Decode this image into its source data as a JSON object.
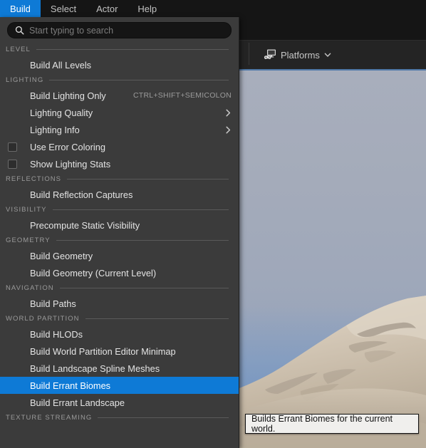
{
  "colors": {
    "accent": "#0e7ad6",
    "menu_bg": "#3b3b3b",
    "chrome_bg": "#151515",
    "toolbar_bg": "#242424",
    "tooltip_bg": "#f0efed",
    "text": "#e4e4e4",
    "section_text": "#9a9a9a",
    "shortcut_text": "#9b9b9b",
    "sky_top": "#a8aebc",
    "sky_bottom": "#7e9ac0",
    "terrain": "#cfc3b2"
  },
  "menubar": {
    "tabs": [
      {
        "label": "Build",
        "active": true
      },
      {
        "label": "Select",
        "active": false
      },
      {
        "label": "Actor",
        "active": false
      },
      {
        "label": "Help",
        "active": false
      }
    ]
  },
  "toolbar": {
    "platforms_label": "Platforms",
    "platforms_icon": "platform-monitor-gamepad-icon",
    "platforms_chevron_icon": "chevron-down-icon"
  },
  "search": {
    "placeholder": "Start typing to search",
    "value": "",
    "icon": "search-icon"
  },
  "menu": {
    "groups": [
      {
        "section": "LEVEL",
        "items": [
          {
            "label": "Build All Levels",
            "shortcut": "",
            "checkbox": false,
            "submenu": false,
            "highlight": false
          }
        ]
      },
      {
        "section": "LIGHTING",
        "items": [
          {
            "label": "Build Lighting Only",
            "shortcut": "CTRL+SHIFT+SEMICOLON",
            "checkbox": false,
            "submenu": false,
            "highlight": false
          },
          {
            "label": "Lighting Quality",
            "shortcut": "",
            "checkbox": false,
            "submenu": true,
            "highlight": false
          },
          {
            "label": "Lighting Info",
            "shortcut": "",
            "checkbox": false,
            "submenu": true,
            "highlight": false
          },
          {
            "label": "Use Error Coloring",
            "shortcut": "",
            "checkbox": true,
            "checked": false,
            "submenu": false,
            "highlight": false
          },
          {
            "label": "Show Lighting Stats",
            "shortcut": "",
            "checkbox": true,
            "checked": false,
            "submenu": false,
            "highlight": false
          }
        ]
      },
      {
        "section": "REFLECTIONS",
        "items": [
          {
            "label": "Build Reflection Captures",
            "shortcut": "",
            "checkbox": false,
            "submenu": false,
            "highlight": false
          }
        ]
      },
      {
        "section": "VISIBILITY",
        "items": [
          {
            "label": "Precompute Static Visibility",
            "shortcut": "",
            "checkbox": false,
            "submenu": false,
            "highlight": false
          }
        ]
      },
      {
        "section": "GEOMETRY",
        "items": [
          {
            "label": "Build Geometry",
            "shortcut": "",
            "checkbox": false,
            "submenu": false,
            "highlight": false
          },
          {
            "label": "Build Geometry (Current Level)",
            "shortcut": "",
            "checkbox": false,
            "submenu": false,
            "highlight": false
          }
        ]
      },
      {
        "section": "NAVIGATION",
        "items": [
          {
            "label": "Build Paths",
            "shortcut": "",
            "checkbox": false,
            "submenu": false,
            "highlight": false
          }
        ]
      },
      {
        "section": "WORLD PARTITION",
        "items": [
          {
            "label": "Build HLODs",
            "shortcut": "",
            "checkbox": false,
            "submenu": false,
            "highlight": false
          },
          {
            "label": "Build World Partition Editor Minimap",
            "shortcut": "",
            "checkbox": false,
            "submenu": false,
            "highlight": false
          },
          {
            "label": "Build Landscape Spline Meshes",
            "shortcut": "",
            "checkbox": false,
            "submenu": false,
            "highlight": false
          },
          {
            "label": "Build Errant Biomes",
            "shortcut": "",
            "checkbox": false,
            "submenu": false,
            "highlight": true
          },
          {
            "label": "Build Errant Landscape",
            "shortcut": "",
            "checkbox": false,
            "submenu": false,
            "highlight": false
          }
        ]
      },
      {
        "section": "TEXTURE STREAMING",
        "items": []
      }
    ]
  },
  "tooltip": {
    "text": "Builds Errant Biomes for the current world."
  }
}
